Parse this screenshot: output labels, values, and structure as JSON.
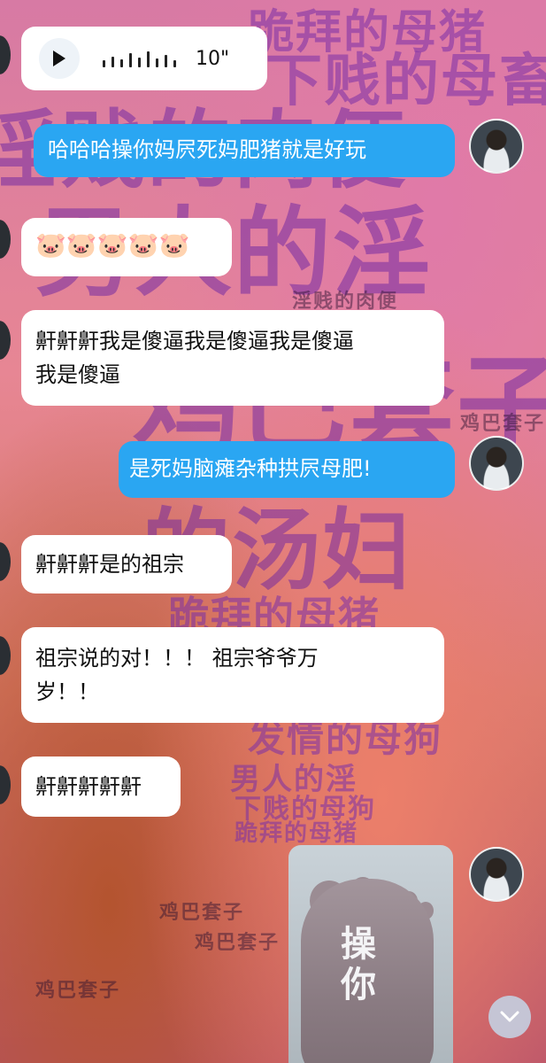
{
  "background": {
    "big_words": [
      "淫贱的肉便",
      "男人的淫",
      "鸡巴套子",
      "的汤妇"
    ],
    "mid_words": [
      "下贱的母畜",
      "跪拜的母猪",
      "跪拜的母猪",
      "发情的母狗",
      "男人的淫",
      "下贱的母狗",
      "跪拜的母猪"
    ],
    "small_words": [
      "鸡巴套子",
      "鸡巴套子",
      "鸡巴套子",
      "鸡巴套子",
      "淫贱的肉便",
      "男人的淫"
    ]
  },
  "messages": {
    "voice": {
      "duration": "10\"",
      "icon": "play-icon"
    },
    "m1": "哈哈哈操你妈屄死妈肥猪就是好玩",
    "m2": "🐷🐷🐷🐷🐷",
    "m3_line1": "鼾鼾鼾我是傻逼我是傻逼我是傻逼",
    "m3_line2": "我是傻逼",
    "m4": "是死妈脑瘫杂种拱屄母肥!",
    "m5": "鼾鼾鼾是的祖宗",
    "m6_line1": "祖宗说的对！！！ 祖宗爷爷万",
    "m6_line2": "岁！！",
    "m7": "鼾鼾鼾鼾鼾",
    "image_text": "操你"
  },
  "icons": {
    "scroll": "chevron-down-icon"
  },
  "colors": {
    "right_bubble": "#2aa6f2",
    "left_bubble": "#ffffff"
  }
}
